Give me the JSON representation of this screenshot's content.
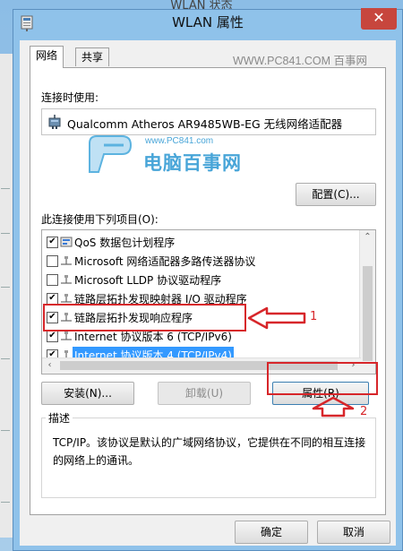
{
  "background_window": {
    "title": "WLAN 状态"
  },
  "window": {
    "title": "WLAN 属性",
    "close_glyph": "✕"
  },
  "tabs": [
    {
      "label": "网络"
    },
    {
      "label": "共享"
    }
  ],
  "watermark": {
    "url": "WWW.PC841.COM 百事网",
    "logo_small": "www.PC841.com",
    "logo_big": "电脑百事网"
  },
  "connect_using": {
    "label": "连接时使用:",
    "adapter": "Qualcomm Atheros AR9485WB-EG 无线网络适配器",
    "configure_button": "配置(C)..."
  },
  "items": {
    "label": "此连接使用下列项目(O):",
    "list": [
      {
        "checked": true,
        "icon": "qos-icon",
        "text": "QoS 数据包计划程序"
      },
      {
        "checked": false,
        "icon": "protocol-icon",
        "text": "Microsoft 网络适配器多路传送器协议"
      },
      {
        "checked": false,
        "icon": "protocol-icon",
        "text": "Microsoft LLDP 协议驱动程序"
      },
      {
        "checked": true,
        "icon": "protocol-icon",
        "text": "链路层拓扑发现映射器 I/O 驱动程序"
      },
      {
        "checked": true,
        "icon": "protocol-icon",
        "text": "链路层拓扑发现响应程序"
      },
      {
        "checked": true,
        "icon": "protocol-icon",
        "text": "Internet 协议版本 6 (TCP/IPv6)"
      },
      {
        "checked": true,
        "icon": "protocol-icon",
        "text": "Internet 协议版本 4 (TCP/IPv4)",
        "selected": true
      }
    ]
  },
  "buttons": {
    "install": "安装(N)...",
    "uninstall": "卸载(U)",
    "properties": "属性(R)",
    "ok": "确定",
    "cancel": "取消"
  },
  "description": {
    "legend": "描述",
    "text": "TCP/IP。该协议是默认的广域网络协议，它提供在不同的相互连接的网络上的通讯。"
  },
  "annotations": {
    "step1": "1",
    "step2": "2"
  },
  "colors": {
    "annotation": "#d7262a",
    "selection": "#3399ff",
    "watermark": "#48a5d8"
  }
}
